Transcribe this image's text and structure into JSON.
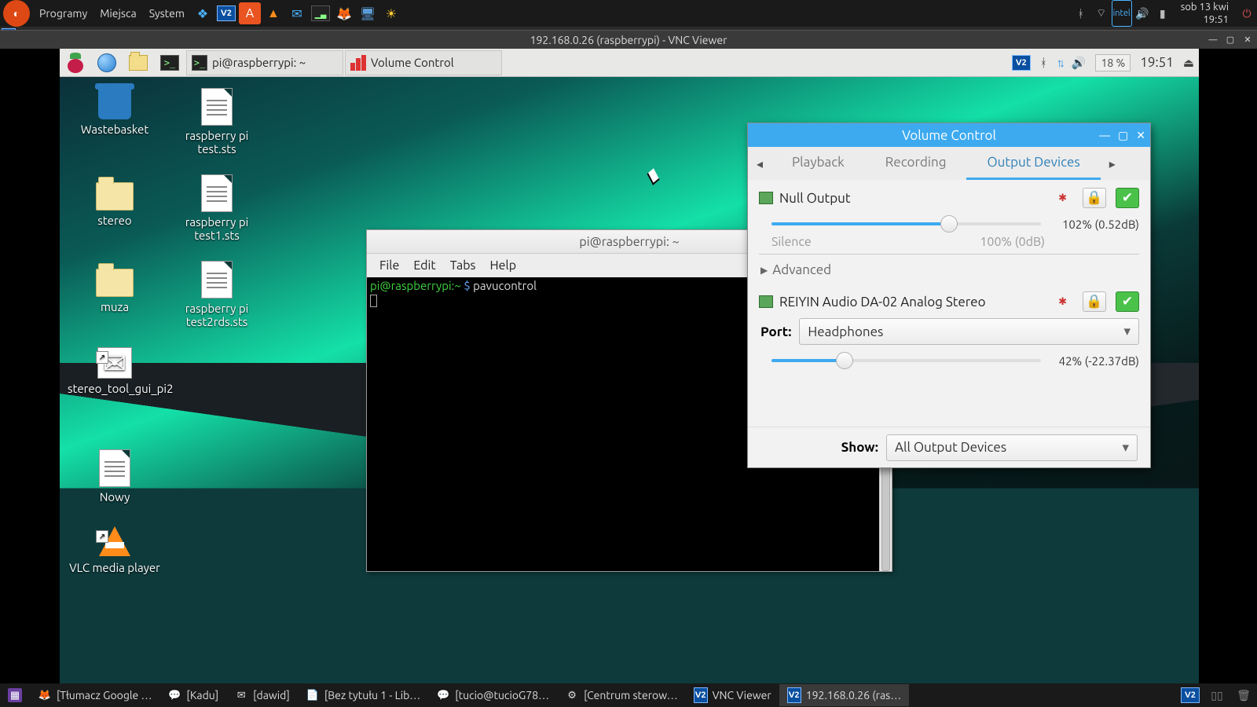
{
  "host_panel": {
    "menus": [
      "Programy",
      "Miejsca",
      "System"
    ],
    "clock_line1": "sob 13 kwi",
    "clock_line2": "19:51"
  },
  "vnc_window": {
    "title": "192.168.0.26 (raspberrypi) - VNC Viewer"
  },
  "rpi_bar": {
    "task_terminal": "pi@raspberrypi: ~",
    "task_volume": "Volume Control",
    "cpu": "18 %",
    "clock": "19:51"
  },
  "desktop_icons": {
    "wastebasket": "Wastebasket",
    "stereo": "stereo",
    "muza": "muza",
    "stereotool": "stereo_tool_gui_pi2",
    "nowy": "Nowy",
    "test": "raspberry pi test.sts",
    "test1": "raspberry pi test1.sts",
    "test2": "raspberry pi test2rds.sts",
    "vlc": "VLC media player"
  },
  "terminal": {
    "title": "pi@raspberrypi: ~",
    "menu": {
      "file": "File",
      "edit": "Edit",
      "tabs": "Tabs",
      "help": "Help"
    },
    "prompt": "pi@raspberrypi:~",
    "dollar": " $ ",
    "command": "pavucontrol"
  },
  "volume_control": {
    "title": "Volume Control",
    "tabs": {
      "playback": "Playback",
      "recording": "Recording",
      "output": "Output Devices"
    },
    "dev1": {
      "name": "Null Output",
      "volume_pct": 102,
      "readout": "102% (0.52dB)",
      "scale_min": "Silence",
      "scale_100": "100% (0dB)"
    },
    "advanced": "Advanced",
    "dev2": {
      "name": "REIYIN Audio DA-02 Analog Stereo",
      "port_label": "Port:",
      "port_value": "Headphones",
      "volume_pct": 42,
      "readout": "42% (-22.37dB)"
    },
    "show_label": "Show:",
    "show_value": "All Output Devices"
  },
  "host_taskbar": {
    "items": [
      "[Tłumacz Google …",
      "[Kadu]",
      "[dawid]",
      "[Bez tytułu 1 - Lib…",
      "[tucio@tucioG78…",
      "[Centrum sterow…",
      "VNC Viewer",
      "192.168.0.26 (ras…"
    ]
  }
}
